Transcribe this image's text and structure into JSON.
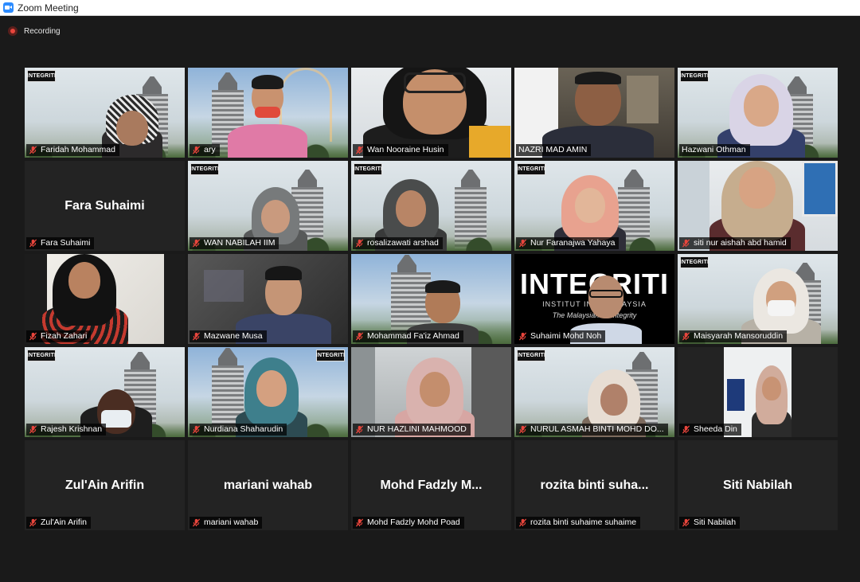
{
  "window": {
    "title": "Zoom Meeting"
  },
  "recording": {
    "label": "Recording"
  },
  "colors": {
    "active_speaker_border": "#c7e84a",
    "muted_mic": "#e8453c",
    "zoom_blue": "#2d8cff"
  },
  "participants": [
    {
      "name": "Faridah Mohammad"
    },
    {
      "name": "ary"
    },
    {
      "name": "Wan Nooraine Husin"
    },
    {
      "name": "NAZRI MAD AMIN",
      "active_speaker": true
    },
    {
      "name": "Hazwani Othman"
    },
    {
      "name": "Fara Suhaimi",
      "display_name": "Fara Suhaimi"
    },
    {
      "name": "WAN NABILAH IIM"
    },
    {
      "name": "rosalizawati arshad"
    },
    {
      "name": "Nur Faranajwa Yahaya"
    },
    {
      "name": "siti nur aishah abd hamid"
    },
    {
      "name": "Fizah Zahari"
    },
    {
      "name": "Mazwane Musa"
    },
    {
      "name": "Mohammad Fa'iz Ahmad"
    },
    {
      "name": "Suhaimi Mohd Noh"
    },
    {
      "name": "Maisyarah Mansoruddin"
    },
    {
      "name": "Rajesh Krishnan"
    },
    {
      "name": "Nurdiana Shaharudin"
    },
    {
      "name": "NUR HAZLINI MAHMOOD"
    },
    {
      "name": "NURUL ASMAH BINTI MOHD DO..."
    },
    {
      "name": "Sheeda Din"
    },
    {
      "name": "Zul'Ain Arifin",
      "display_name": "Zul'Ain Arifin"
    },
    {
      "name": "mariani wahab",
      "display_name": "mariani wahab"
    },
    {
      "name": "Mohd Fadzly Mohd Poad",
      "display_name": "Mohd Fadzly M..."
    },
    {
      "name": "rozita binti suhaime suhaime",
      "display_name": "rozita binti suha..."
    },
    {
      "name": "Siti Nabilah",
      "display_name": "Siti Nabilah"
    }
  ],
  "branding": {
    "logo_text": "INTEGRITI",
    "institute_line": "INSTITUT INTE...ALAYSIA",
    "tagline": "The Malaysian I... Integrity"
  }
}
